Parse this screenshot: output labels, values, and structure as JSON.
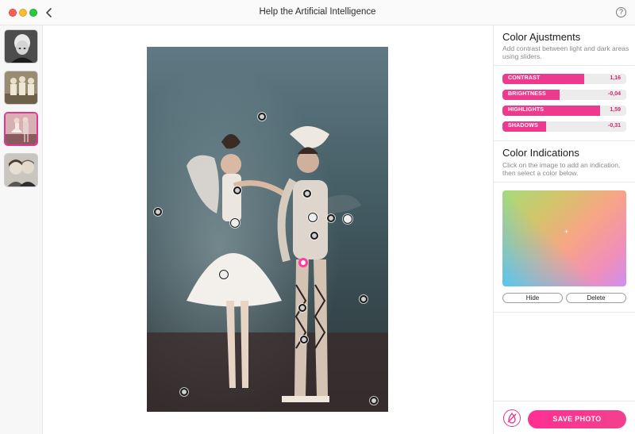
{
  "window": {
    "title": "Help the Artificial Intelligence",
    "help_glyph": "?"
  },
  "sidebar": {
    "thumbnails": [
      {
        "name": "portrait-woman-bw",
        "active": false
      },
      {
        "name": "group-dancers-sepia",
        "active": false
      },
      {
        "name": "two-dancers-costume",
        "active": true
      },
      {
        "name": "couple-smiling",
        "active": false
      }
    ]
  },
  "canvas": {
    "color_marker_count": 17
  },
  "color_adjustments": {
    "title": "Color Ajustments",
    "description": "Add contrast between light and dark areas using sliders.",
    "sliders": [
      {
        "label": "CONTRAST",
        "value": "1,16",
        "fill_fraction": 0.66
      },
      {
        "label": "BRIGHTNESS",
        "value": "-0,04",
        "fill_fraction": 0.46
      },
      {
        "label": "HIGHLIGHTS",
        "value": "1,59",
        "fill_fraction": 0.79
      },
      {
        "label": "SHADOWS",
        "value": "-0,31",
        "fill_fraction": 0.35
      }
    ],
    "accent_color": "#ee3a8e"
  },
  "color_indications": {
    "title": "Color Indications",
    "description": "Click on the image to add an indication, then select a color below.",
    "hide_label": "Hide",
    "delete_label": "Delete"
  },
  "footer": {
    "save_label": "SAVE PHOTO",
    "icon": "color-drop-off-icon"
  }
}
